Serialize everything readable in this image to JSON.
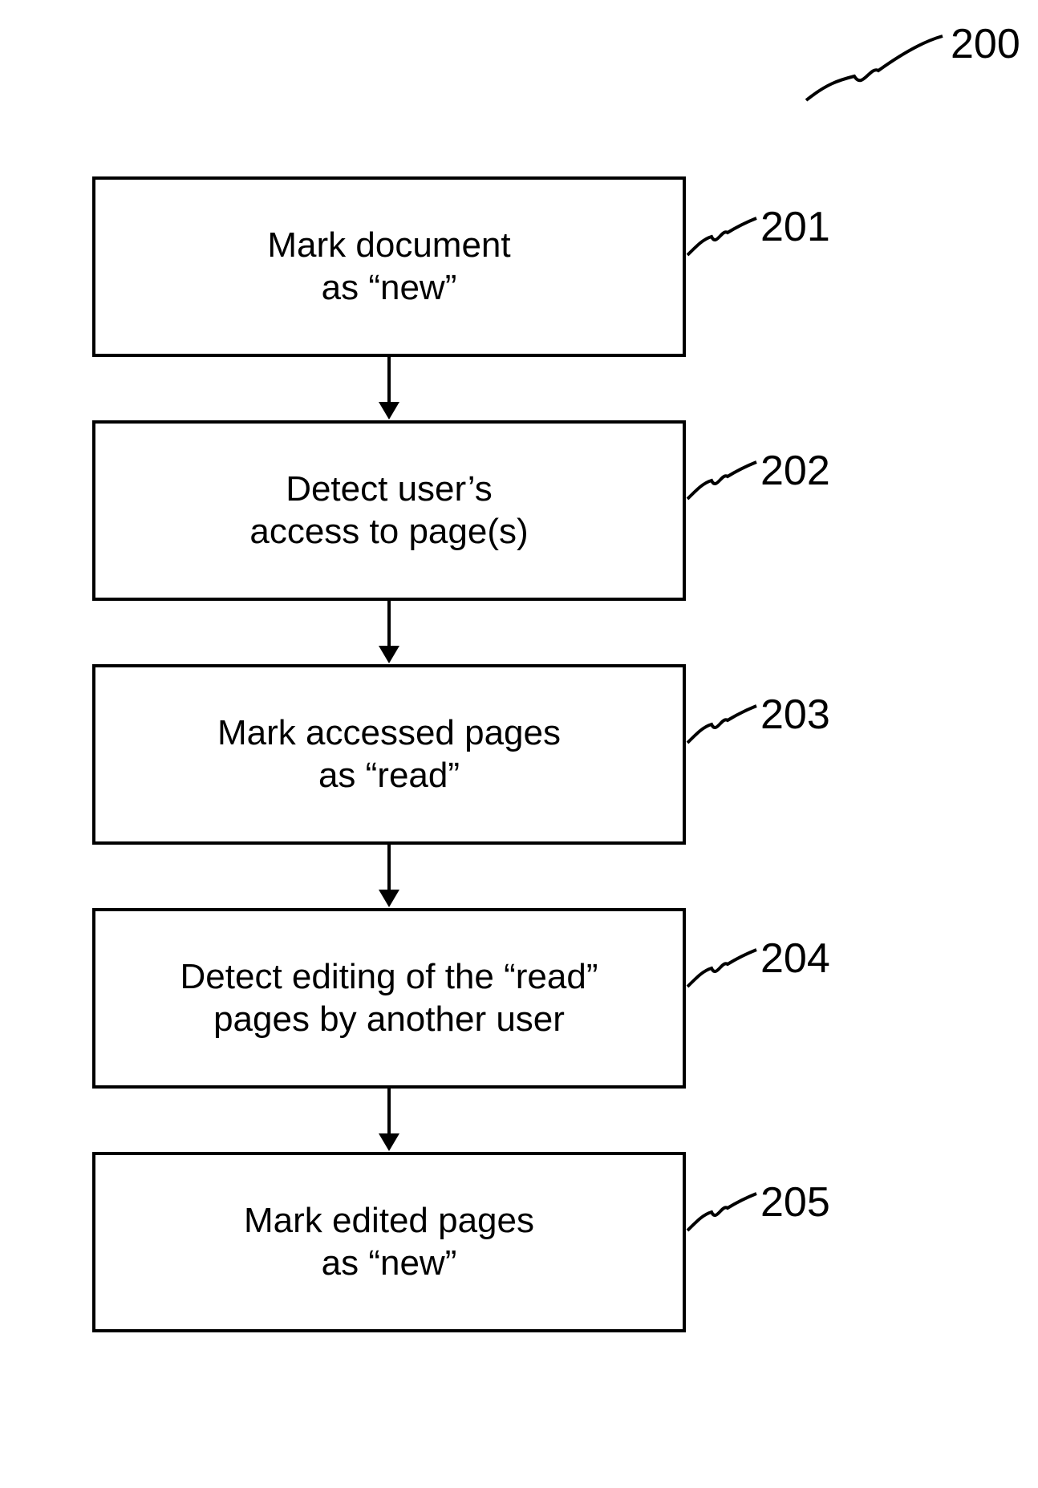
{
  "figure_ref": "200",
  "steps": [
    {
      "ref": "201",
      "line1": "Mark document",
      "line2": "as “new”"
    },
    {
      "ref": "202",
      "line1": "Detect user’s",
      "line2": "access to page(s)"
    },
    {
      "ref": "203",
      "line1": "Mark accessed pages",
      "line2": "as “read”"
    },
    {
      "ref": "204",
      "line1": "Detect editing of the “read”",
      "line2": "pages by another user"
    },
    {
      "ref": "205",
      "line1": "Mark edited pages",
      "line2": "as “new”"
    }
  ]
}
